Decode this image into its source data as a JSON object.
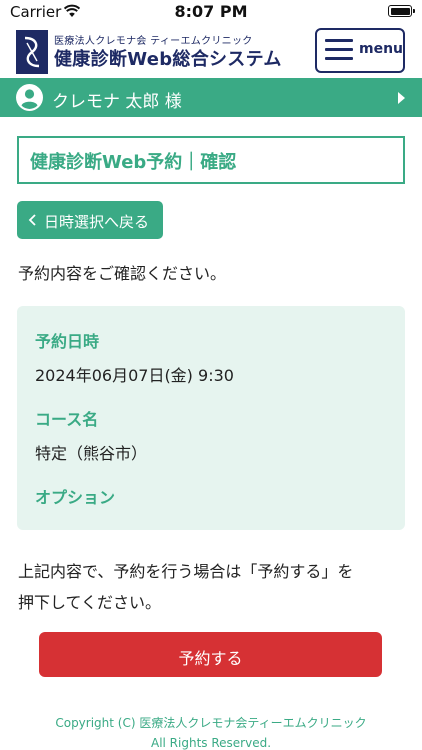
{
  "status_bar": {
    "carrier": "Carrier",
    "time": "8:07 PM"
  },
  "header": {
    "org_name": "医療法人クレモナ会 ティーエムクリニック",
    "system_title": "健康診断Web総合システム",
    "menu_label": "menu"
  },
  "user_bar": {
    "user_name": "クレモナ 太郎 様"
  },
  "page": {
    "title": "健康診断Web予約｜確認",
    "back_label": "日時選択へ戻る",
    "instruction": "予約内容をご確認ください。",
    "reservation": {
      "datetime_label": "予約日時",
      "datetime_value": "2024年06月07日(金) 9:30",
      "course_label": "コース名",
      "course_value": "特定（熊谷市）",
      "option_label": "オプション"
    },
    "note_line1": "上記内容で、予約を行う場合は「予約する」を",
    "note_line2": "押下してください。",
    "reserve_label": "予約する"
  },
  "footer": {
    "copyright_line1": "Copyright (C) 医療法人クレモナ会ティーエムクリニック",
    "copyright_line2": "All Rights Reserved."
  },
  "colors": {
    "accent_green": "#3aaa85",
    "navy": "#1e2a64",
    "reserve_red": "#d63134",
    "panel_bg": "#e6f4ef"
  },
  "icons": {
    "wifi": "wifi-icon",
    "battery": "battery-icon",
    "logo": "clinic-logo",
    "menu": "hamburger-icon",
    "user": "user-avatar-icon",
    "user_arrow": "chevron-right-icon",
    "back": "chevron-left-icon"
  }
}
